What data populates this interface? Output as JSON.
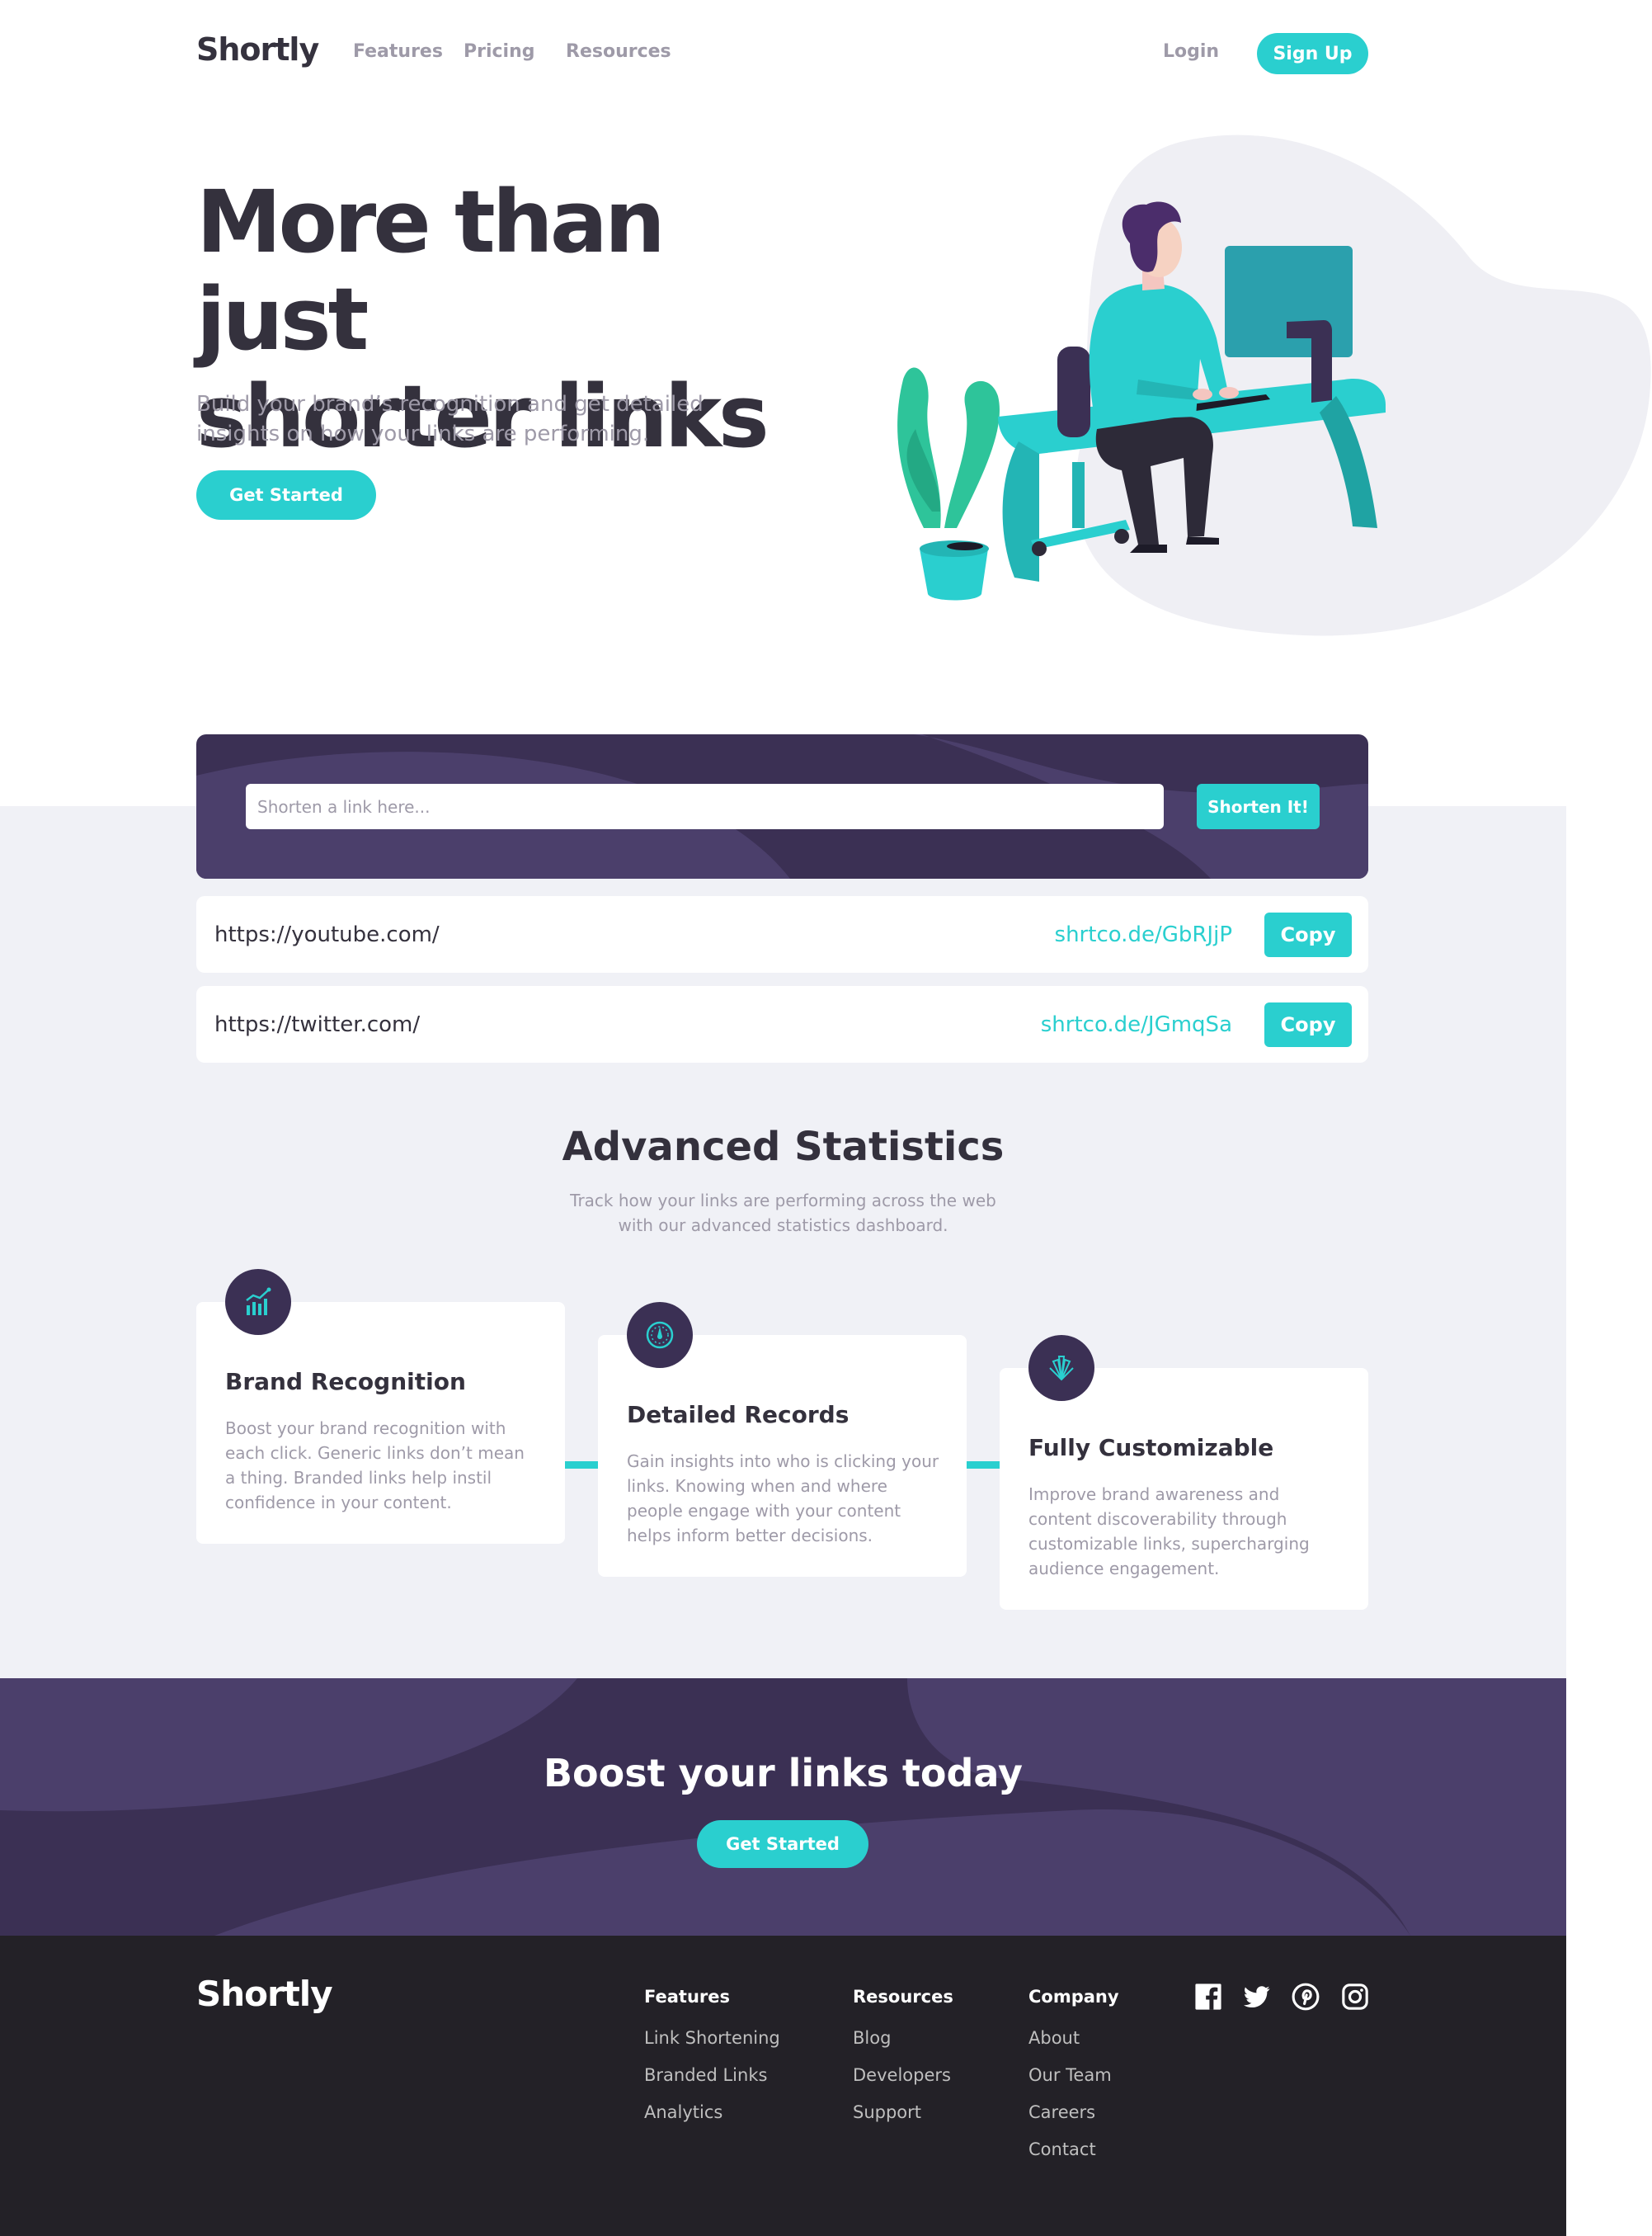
{
  "header": {
    "logo": "Shortly",
    "nav": [
      {
        "label": "Features"
      },
      {
        "label": "Pricing"
      },
      {
        "label": "Resources"
      }
    ],
    "login_label": "Login",
    "signup_label": "Sign Up"
  },
  "hero": {
    "title_line1": "More than just",
    "title_line2": "shorter links",
    "subtitle_line1": "Build your brand’s recognition and get detailed",
    "subtitle_line2": "insights on how your links are performing.",
    "cta_label": "Get Started",
    "illustration_icon": "person-working-at-desk-illustration"
  },
  "shorten": {
    "placeholder": "Shorten a link here...",
    "button_label": "Shorten It!"
  },
  "results": [
    {
      "original": "https://youtube.com/",
      "short": "shrtco.de/GbRJjP",
      "copy_label": "Copy"
    },
    {
      "original": "https://twitter.com/",
      "short": "shrtco.de/JGmqSa",
      "copy_label": "Copy"
    }
  ],
  "stats": {
    "title": "Advanced Statistics",
    "subtitle_line1": "Track how your links are performing across the web",
    "subtitle_line2": "with our advanced statistics dashboard.",
    "cards": [
      {
        "icon": "brand-recognition-chart-icon",
        "title": "Brand Recognition",
        "text": "Boost your brand recognition with each click. Generic links don’t mean a thing. Branded links help instil confidence in your content."
      },
      {
        "icon": "detailed-records-gauge-icon",
        "title": "Detailed Records",
        "text": "Gain insights into who is clicking your links. Knowing when and where people engage with your content helps inform better decisions."
      },
      {
        "icon": "fully-customizable-brushes-icon",
        "title": "Fully Customizable",
        "text": "Improve brand awareness and content discoverability through customizable links, supercharging audience engagement."
      }
    ]
  },
  "boost": {
    "title": "Boost your links today",
    "cta_label": "Get Started"
  },
  "footer": {
    "logo": "Shortly",
    "columns": [
      {
        "heading": "Features",
        "links": [
          "Link Shortening",
          "Branded Links",
          "Analytics"
        ]
      },
      {
        "heading": "Resources",
        "links": [
          "Blog",
          "Developers",
          "Support"
        ]
      },
      {
        "heading": "Company",
        "links": [
          "About",
          "Our Team",
          "Careers",
          "Contact"
        ]
      }
    ],
    "social_icons": [
      "facebook-icon",
      "twitter-icon",
      "pinterest-icon",
      "instagram-icon"
    ]
  },
  "colors": {
    "cyan": "#2acfcf",
    "dark_violet": "#3b3054",
    "grayish_violet": "#9e9aa8",
    "very_dark_blue": "#34313d",
    "light_gray_bg": "#f0f1f6",
    "footer_bg": "#232127"
  }
}
